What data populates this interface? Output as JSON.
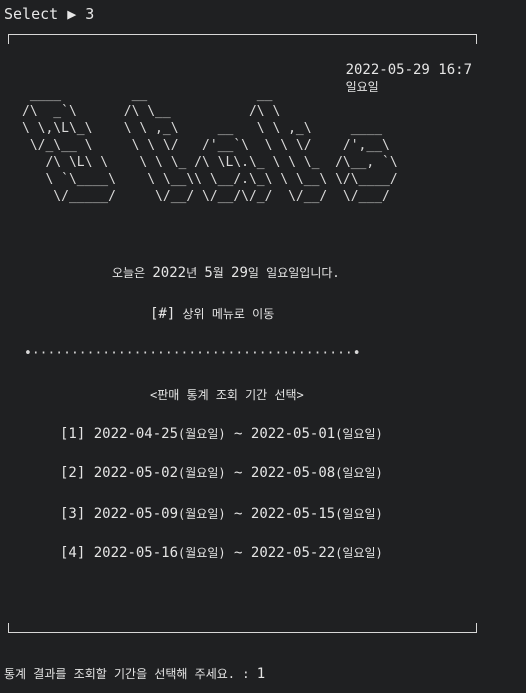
{
  "window": {
    "title": "Select ▶ 3"
  },
  "header": {
    "date": "2022-05-29 16:7",
    "weekday": "일요일"
  },
  "ascii_art": [
    " ____         __              __",
    "/\\  _`\\      /\\ \\__          /\\ \\",
    "\\ \\,\\L\\_\\    \\ \\ ,_\\     __   \\ \\ ,_\\     ____",
    " \\/_\\__ \\     \\ \\ \\/   /'__`\\  \\ \\ \\/    /',__\\",
    "   /\\ \\L\\ \\    \\ \\ \\_ /\\ \\L\\.\\_ \\ \\ \\_  /\\__, `\\",
    "   \\ `\\____\\    \\ \\__\\\\ \\__/.\\_\\ \\ \\__\\ \\/\\____/",
    "    \\/_____/     \\/__/ \\/__/\\/_/  \\/__/  \\/___/"
  ],
  "today": {
    "prefix": "오늘은 ",
    "year": "2022",
    "year_unit": "년 ",
    "month": "5",
    "month_unit": "월 ",
    "day": "29",
    "day_unit": "일 ",
    "weekday": "일요일입니다."
  },
  "menu_link": {
    "key": "[#]",
    "label": " 상위 메뉴로 이동"
  },
  "divider": "•·········································•",
  "period_title": "<판매 통계 조회 기간 선택>",
  "periods": [
    {
      "index": "[1]",
      "start": "2022-04-25",
      "start_day": "(월요일)",
      "sep": " ~ ",
      "end": "2022-05-01",
      "end_day": "(일요일)"
    },
    {
      "index": "[2]",
      "start": "2022-05-02",
      "start_day": "(월요일)",
      "sep": " ~ ",
      "end": "2022-05-08",
      "end_day": "(일요일)"
    },
    {
      "index": "[3]",
      "start": "2022-05-09",
      "start_day": "(월요일)",
      "sep": " ~ ",
      "end": "2022-05-15",
      "end_day": "(일요일)"
    },
    {
      "index": "[4]",
      "start": "2022-05-16",
      "start_day": "(월요일)",
      "sep": " ~ ",
      "end": "2022-05-22",
      "end_day": "(일요일)"
    }
  ],
  "prompt": {
    "label": "통계 결과를 조회할 기간을 선택해 주세요. : ",
    "value": "1"
  }
}
